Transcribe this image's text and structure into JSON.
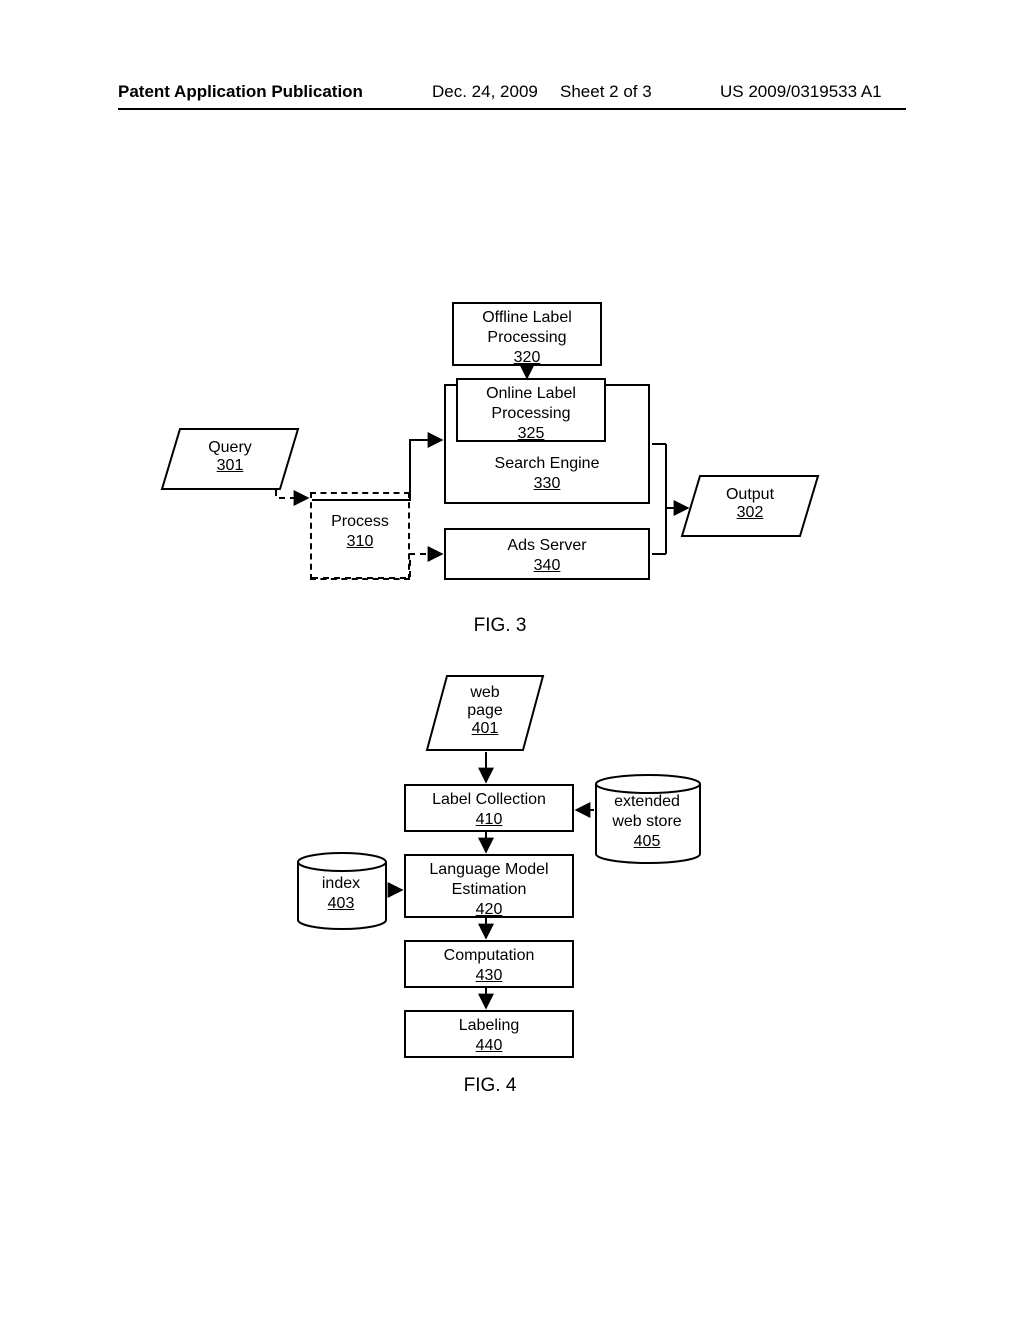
{
  "header": {
    "pub": "Patent Application Publication",
    "date": "Dec. 24, 2009",
    "sheet": "Sheet 2 of 3",
    "num": "US 2009/0319533 A1"
  },
  "fig3": {
    "query": {
      "label": "Query",
      "ref": "301"
    },
    "process": {
      "label": "Process",
      "ref": "310"
    },
    "offline": {
      "label1": "Offline Label",
      "label2": "Processing",
      "ref": "320"
    },
    "online": {
      "label1": "Online Label",
      "label2": "Processing",
      "ref": "325"
    },
    "engine": {
      "label": "Search Engine",
      "ref": "330"
    },
    "ads": {
      "label": "Ads Server",
      "ref": "340"
    },
    "output": {
      "label": "Output",
      "ref": "302"
    },
    "caption": "FIG. 3"
  },
  "fig4": {
    "webpage": {
      "label1": "web",
      "label2": "page",
      "ref": "401"
    },
    "index": {
      "label": "index",
      "ref": "403"
    },
    "webstore": {
      "label1": "extended",
      "label2": "web store",
      "ref": "405"
    },
    "collect": {
      "label": "Label Collection",
      "ref": "410"
    },
    "lm": {
      "label1": "Language Model",
      "label2": "Estimation",
      "ref": "420"
    },
    "comp": {
      "label": "Computation",
      "ref": "430"
    },
    "labeling": {
      "label": "Labeling",
      "ref": "440"
    },
    "caption": "FIG. 4"
  }
}
